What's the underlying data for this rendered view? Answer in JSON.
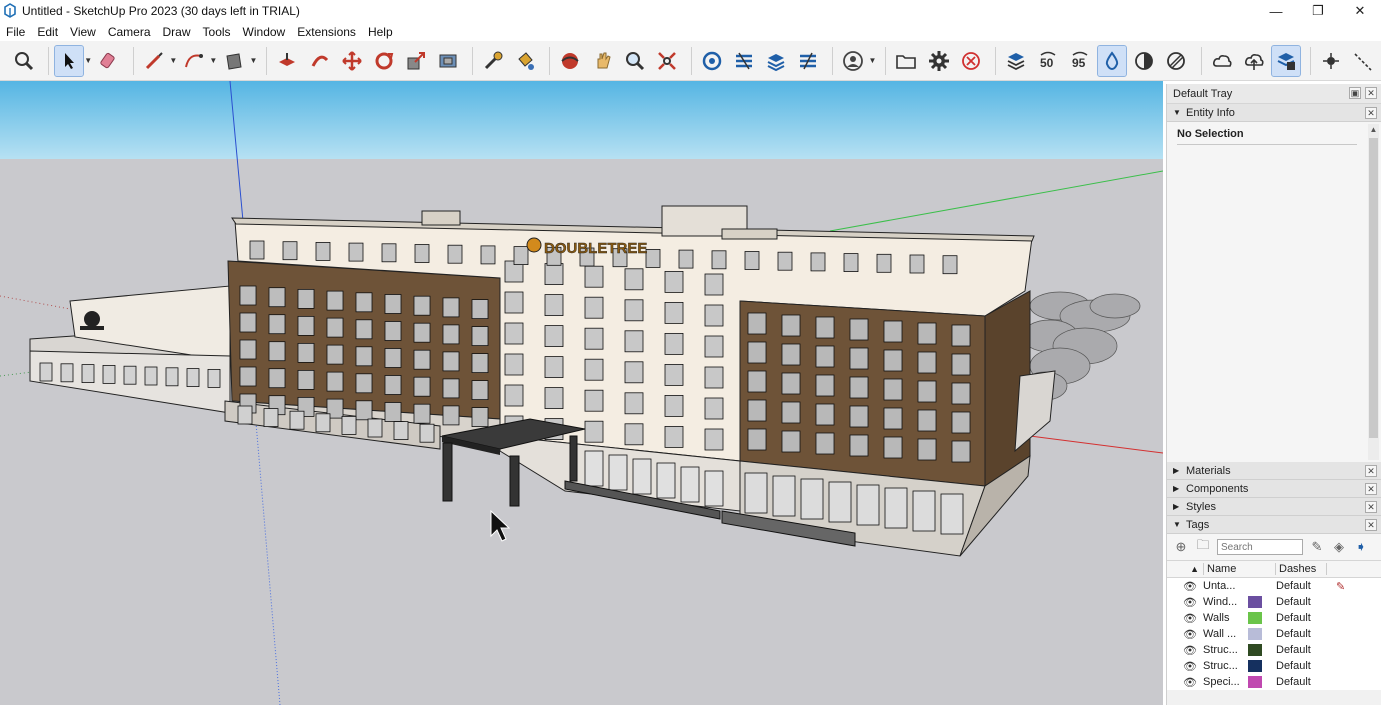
{
  "window": {
    "title": "Untitled - SketchUp Pro 2023 (30 days left in TRIAL)",
    "controls": {
      "minimize": "—",
      "restore": "❐",
      "close": "✕"
    }
  },
  "menu": [
    "File",
    "Edit",
    "View",
    "Camera",
    "Draw",
    "Tools",
    "Window",
    "Extensions",
    "Help"
  ],
  "toolbar": {
    "icons": [
      "zoom-icon",
      "select-icon",
      "eraser-icon",
      "line-icon",
      "arc-icon",
      "rectangle-icon",
      "push-pull-icon",
      "follow-me-icon",
      "move-icon",
      "rotate-icon",
      "scale-icon",
      "offset-icon",
      "tape-measure-icon",
      "paint-bucket-icon",
      "orbit-icon",
      "pan-icon",
      "zoom-window-icon",
      "zoom-extents-icon",
      "warehouse-icon",
      "extension-warehouse-icon",
      "layout-icon",
      "sandbox-icon",
      "profile-icon",
      "open-folder-icon",
      "settings-icon",
      "stop-icon",
      "geo-icon",
      "rotate50-icon",
      "rotate95-icon",
      "water-drop-icon",
      "contrast-icon",
      "section-icon",
      "cloud-icon",
      "cloud-upload-icon",
      "model-info-icon",
      "dot-icon",
      "dimension-icon"
    ]
  },
  "tray": {
    "title": "Default Tray",
    "entity_info": {
      "label": "Entity Info",
      "status": "No Selection"
    },
    "collapsed_panels": [
      "Materials",
      "Components",
      "Styles"
    ],
    "tags": {
      "label": "Tags",
      "search_placeholder": "Search",
      "columns": {
        "name": "Name",
        "dashes": "Dashes"
      },
      "rows": [
        {
          "name": "Unta...",
          "color": "",
          "dashes": "Default",
          "active": true
        },
        {
          "name": "Wind...",
          "color": "#6b4fa0",
          "dashes": "Default",
          "active": false
        },
        {
          "name": "Walls",
          "color": "#6ac44a",
          "dashes": "Default",
          "active": false
        },
        {
          "name": "Wall ...",
          "color": "#b8bcd8",
          "dashes": "Default",
          "active": false
        },
        {
          "name": "Struc...",
          "color": "#2f4a22",
          "dashes": "Default",
          "active": false
        },
        {
          "name": "Struc...",
          "color": "#15305f",
          "dashes": "Default",
          "active": false
        },
        {
          "name": "Speci...",
          "color": "#c048b0",
          "dashes": "Default",
          "active": false
        }
      ]
    }
  },
  "viewport": {
    "sky_color": "#6fc4e8",
    "ground_color": "#c9c9cd",
    "sign_text": "DOUBLETREE"
  }
}
